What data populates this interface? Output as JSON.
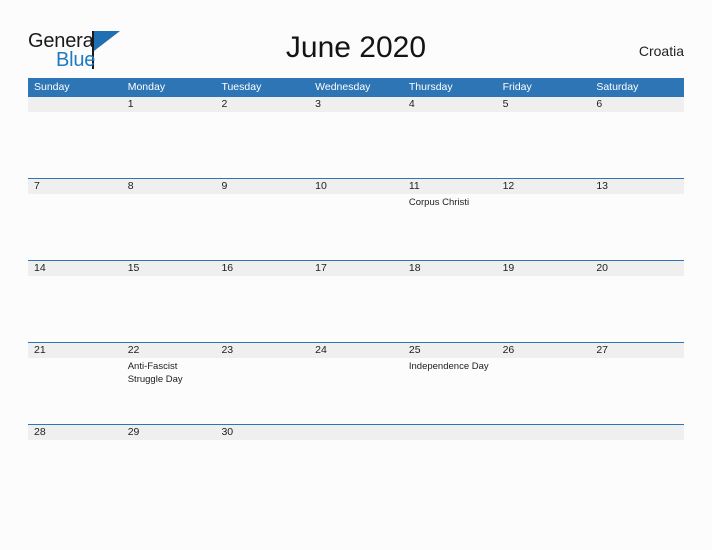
{
  "brand": {
    "name_part1": "General",
    "name_part2": "Blue",
    "logo_icon": "blue-triangle-icon",
    "accent_color": "#1f7ac0"
  },
  "header": {
    "title": "June 2020",
    "region": "Croatia"
  },
  "theme": {
    "header_blue": "#2e75b6",
    "band_gray": "#efefef",
    "page_background": "#fcfcfc",
    "text_color": "#1d1d1d"
  },
  "calendar": {
    "month": "June",
    "year": "2020",
    "weekday_headers": [
      "Sunday",
      "Monday",
      "Tuesday",
      "Wednesday",
      "Thursday",
      "Friday",
      "Saturday"
    ],
    "weeks": [
      {
        "days": [
          {
            "date": "",
            "events": []
          },
          {
            "date": "1",
            "events": []
          },
          {
            "date": "2",
            "events": []
          },
          {
            "date": "3",
            "events": []
          },
          {
            "date": "4",
            "events": []
          },
          {
            "date": "5",
            "events": []
          },
          {
            "date": "6",
            "events": []
          }
        ]
      },
      {
        "days": [
          {
            "date": "7",
            "events": []
          },
          {
            "date": "8",
            "events": []
          },
          {
            "date": "9",
            "events": []
          },
          {
            "date": "10",
            "events": []
          },
          {
            "date": "11",
            "events": [
              "Corpus Christi"
            ]
          },
          {
            "date": "12",
            "events": []
          },
          {
            "date": "13",
            "events": []
          }
        ]
      },
      {
        "days": [
          {
            "date": "14",
            "events": []
          },
          {
            "date": "15",
            "events": []
          },
          {
            "date": "16",
            "events": []
          },
          {
            "date": "17",
            "events": []
          },
          {
            "date": "18",
            "events": []
          },
          {
            "date": "19",
            "events": []
          },
          {
            "date": "20",
            "events": []
          }
        ]
      },
      {
        "days": [
          {
            "date": "21",
            "events": []
          },
          {
            "date": "22",
            "events": [
              "Anti-Fascist Struggle Day"
            ]
          },
          {
            "date": "23",
            "events": []
          },
          {
            "date": "24",
            "events": []
          },
          {
            "date": "25",
            "events": [
              "Independence Day"
            ]
          },
          {
            "date": "26",
            "events": []
          },
          {
            "date": "27",
            "events": []
          }
        ]
      },
      {
        "last": true,
        "days": [
          {
            "date": "28",
            "events": []
          },
          {
            "date": "29",
            "events": []
          },
          {
            "date": "30",
            "events": []
          },
          {
            "date": "",
            "events": []
          },
          {
            "date": "",
            "events": []
          },
          {
            "date": "",
            "events": []
          },
          {
            "date": "",
            "events": []
          }
        ]
      }
    ]
  }
}
